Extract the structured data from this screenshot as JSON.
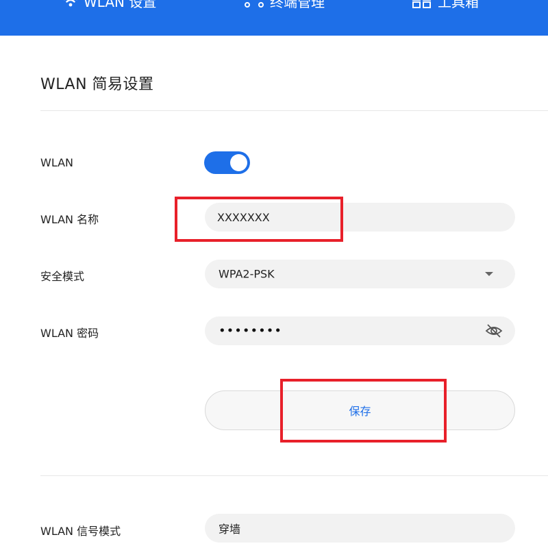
{
  "topbar": {
    "items": [
      {
        "label": "WLAN 设置",
        "icon": "wifi-icon"
      },
      {
        "label": "终端管理",
        "icon": "devices-icon"
      },
      {
        "label": "工具箱",
        "icon": "grid-icon"
      }
    ]
  },
  "section": {
    "title": "WLAN 简易设置"
  },
  "form": {
    "wlan_switch": {
      "label": "WLAN",
      "state": "on"
    },
    "wlan_name": {
      "label": "WLAN 名称",
      "value": "XXXXXXX"
    },
    "security_mode": {
      "label": "安全模式",
      "value": "WPA2-PSK"
    },
    "wlan_password": {
      "label": "WLAN 密码",
      "value": "••••••••"
    },
    "save_label": "保存"
  },
  "signal": {
    "label": "WLAN 信号模式",
    "value": "穿墙"
  },
  "colors": {
    "accent": "#1e6fe8",
    "highlight": "#e8202a",
    "field_bg": "#f2f2f2"
  }
}
